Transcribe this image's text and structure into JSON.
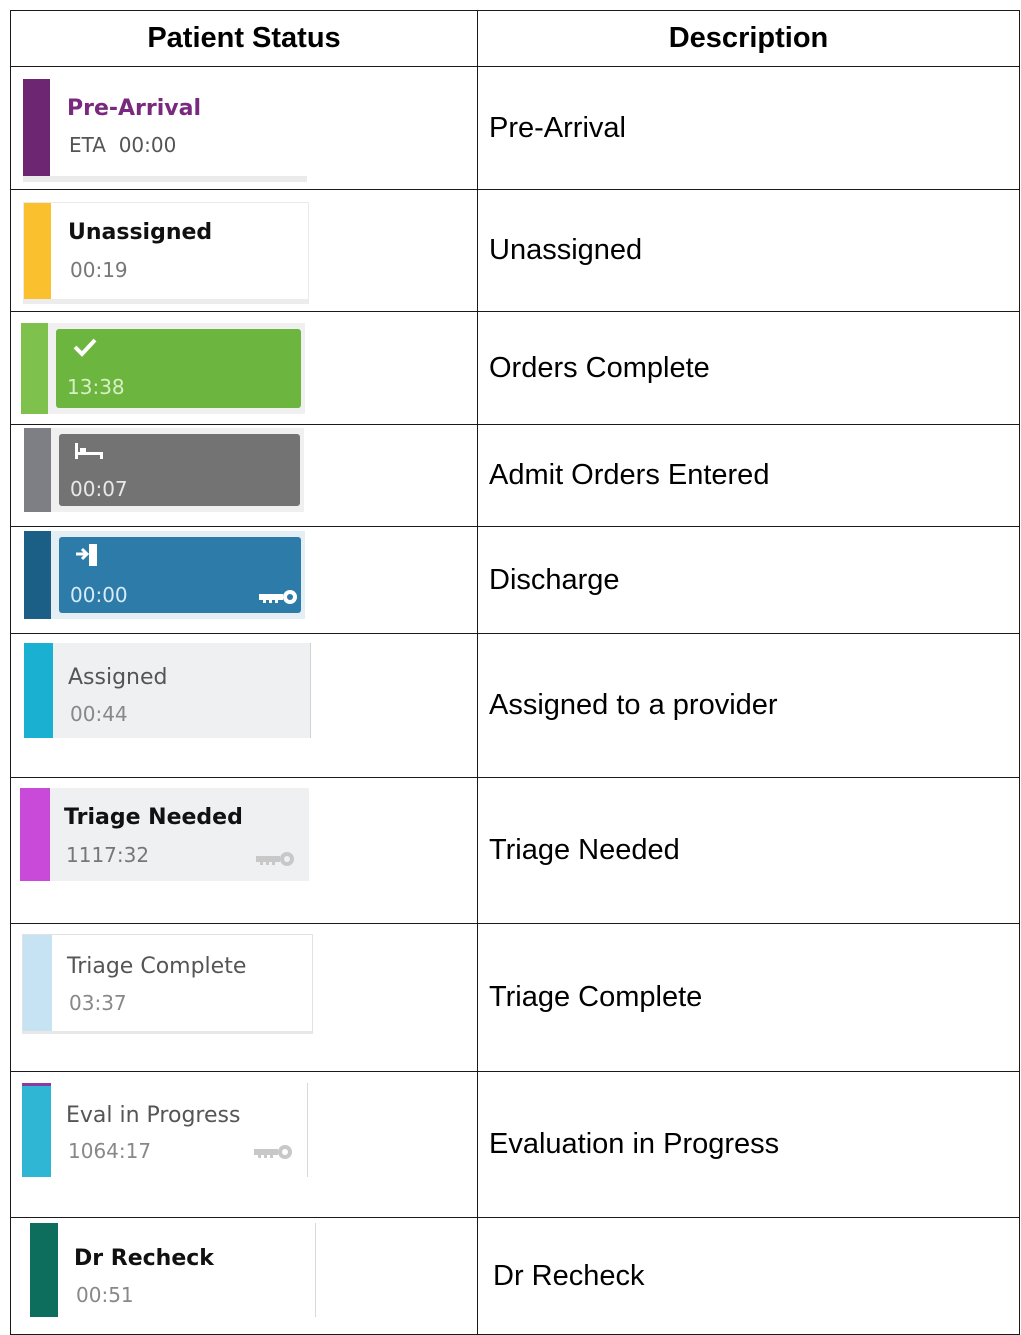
{
  "headers": {
    "status": "Patient Status",
    "description": "Description"
  },
  "rows": [
    {
      "badge": {
        "title": "Pre-Arrival",
        "time": "ETA  00:00",
        "stripe_color": "#6c2672",
        "title_color": "#7a2a7e"
      },
      "description": "Pre-Arrival"
    },
    {
      "badge": {
        "title": "Unassigned",
        "time": "00:19",
        "stripe_color": "#fbc02d",
        "title_color": "#111111"
      },
      "description": "Unassigned"
    },
    {
      "badge": {
        "icon": "checkmark-icon",
        "time": "13:38",
        "stripe_color": "#7ec14d",
        "fill_color": "#6cb53f"
      },
      "description": "Orders Complete"
    },
    {
      "badge": {
        "icon": "bed-icon",
        "time": "00:07",
        "stripe_color": "#7e7f84",
        "fill_color": "#737373"
      },
      "description": "Admit Orders Entered"
    },
    {
      "badge": {
        "icon": "exit-door-icon",
        "time": "00:00",
        "stripe_color": "#1b5f86",
        "fill_color": "#2d7ba8",
        "key": "key-icon"
      },
      "description": "Discharge"
    },
    {
      "badge": {
        "title": "Assigned",
        "time": "00:44",
        "stripe_color": "#1ab0d2",
        "title_color": "#555555"
      },
      "description": "Assigned to a provider"
    },
    {
      "badge": {
        "title": "Triage Needed",
        "time": "1117:32",
        "stripe_color": "#c94ad8",
        "title_color": "#111111",
        "key": "key-icon"
      },
      "description": "Triage Needed"
    },
    {
      "badge": {
        "title": "Triage Complete",
        "time": "03:37",
        "stripe_color": "#c6e3f3",
        "title_color": "#555555"
      },
      "description": "Triage Complete"
    },
    {
      "badge": {
        "title": "Eval in Progress",
        "time": "1064:17",
        "stripe_color": "#2fb6d4",
        "title_color": "#555555",
        "key": "key-icon"
      },
      "description": "Evaluation in Progress"
    },
    {
      "badge": {
        "title": "Dr Recheck",
        "time": "00:51",
        "stripe_color": "#0d6e5e",
        "title_color": "#111111"
      },
      "description": "Dr Recheck"
    }
  ]
}
